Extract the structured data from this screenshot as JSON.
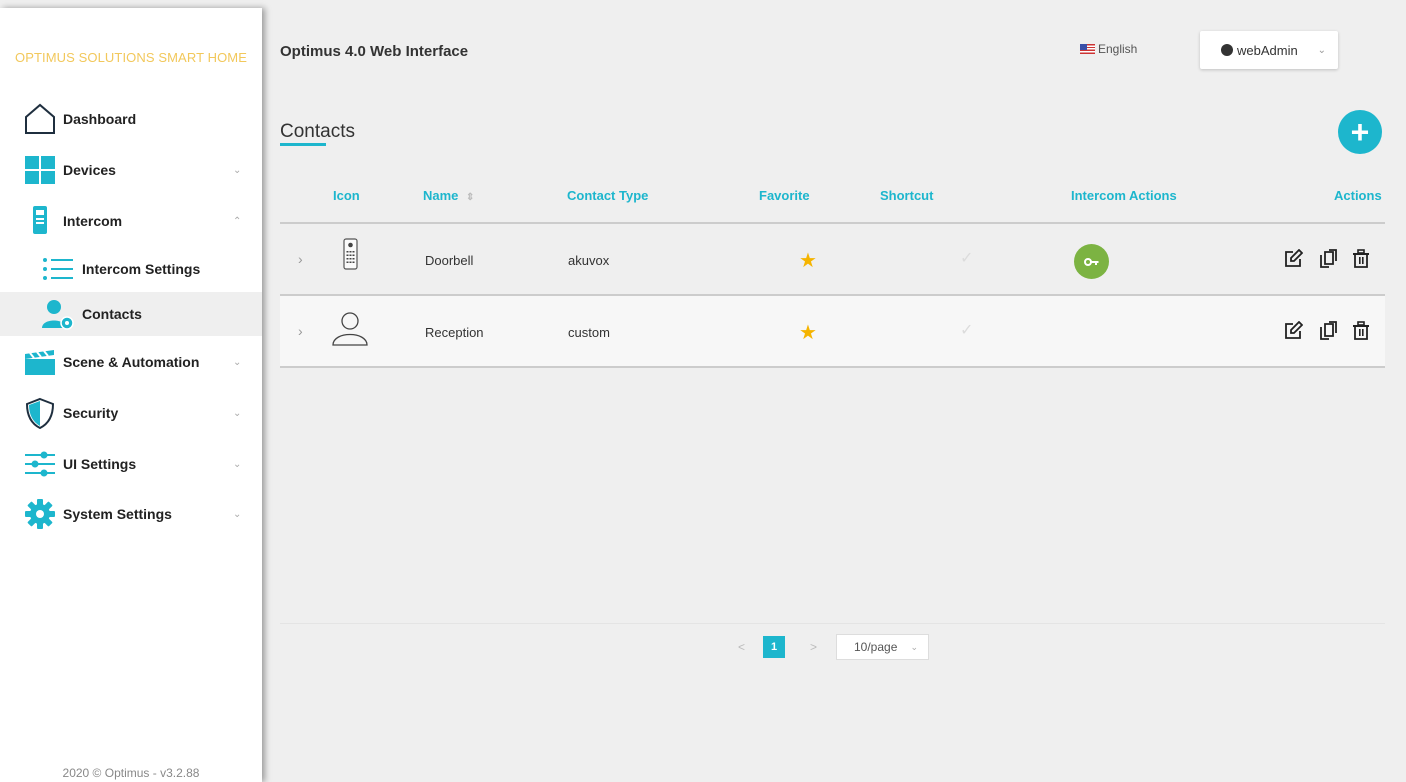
{
  "sidebar": {
    "brand": "OPTIMUS SOLUTIONS SMART HOME",
    "items": [
      {
        "label": "Dashboard",
        "icon": "home-icon"
      },
      {
        "label": "Devices",
        "icon": "grid-icon"
      },
      {
        "label": "Intercom",
        "icon": "intercom-icon"
      },
      {
        "label": "Intercom Settings",
        "icon": "list-icon"
      },
      {
        "label": "Contacts",
        "icon": "contact-user-icon"
      },
      {
        "label": "Scene & Automation",
        "icon": "clapperboard-icon"
      },
      {
        "label": "Security",
        "icon": "shield-icon"
      },
      {
        "label": "UI Settings",
        "icon": "sliders-icon"
      },
      {
        "label": "System Settings",
        "icon": "gear-icon"
      }
    ],
    "footer": "2020 © Optimus - v3.2.88"
  },
  "header": {
    "app_title": "Optimus 4.0 Web Interface",
    "language": "English",
    "user": "webAdmin"
  },
  "page": {
    "title": "Contacts"
  },
  "table": {
    "columns": [
      "Icon",
      "Name",
      "Contact Type",
      "Favorite",
      "Shortcut",
      "Intercom Actions",
      "Actions"
    ],
    "rows": [
      {
        "name": "Doorbell",
        "type": "akuvox",
        "favorite": true,
        "shortcut": false,
        "icon": "doorbell-panel-icon",
        "intercom_action": "key-icon"
      },
      {
        "name": "Reception",
        "type": "custom",
        "favorite": true,
        "shortcut": false,
        "icon": "person-outline-icon",
        "intercom_action": ""
      }
    ]
  },
  "pagination": {
    "current_page": "1",
    "page_size": "10/page"
  },
  "colors": {
    "accent": "#1db6cd",
    "brand": "#f2c85b",
    "star": "#f5b400",
    "key_button": "#7cb342"
  }
}
